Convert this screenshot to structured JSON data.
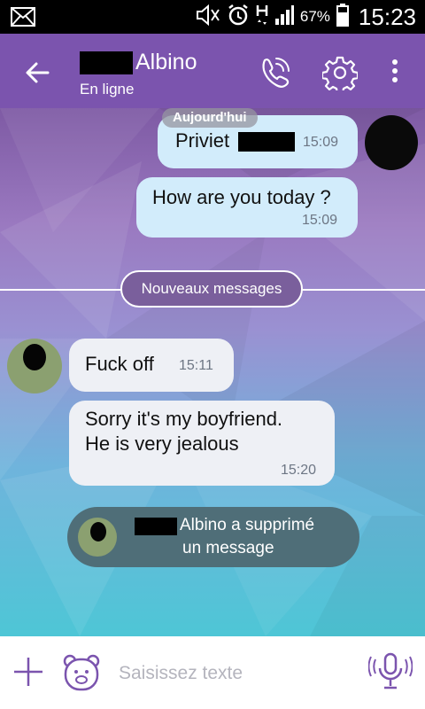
{
  "status_bar": {
    "battery_percent": "67%",
    "time": "15:23",
    "icons": [
      "mail-icon",
      "mute-icon",
      "alarm-icon",
      "data-h-icon",
      "signal-icon",
      "battery-icon"
    ]
  },
  "header": {
    "title": "Albino",
    "subtitle": "En ligne",
    "icons": [
      "back-arrow-icon",
      "phone-icon",
      "gear-icon",
      "more-vert-icon"
    ]
  },
  "chat": {
    "day_label": "Aujourd'hui",
    "messages": [
      {
        "direction": "out",
        "text": "Priviet",
        "time": "15:09"
      },
      {
        "direction": "out",
        "text": "How are you today ?",
        "time": "15:09"
      },
      {
        "direction": "in",
        "text": "Fuck off",
        "time": "15:11"
      },
      {
        "direction": "in",
        "lines": [
          "Sorry it's my boyfriend.",
          "He is very jealous"
        ],
        "time": "15:20"
      }
    ],
    "new_messages_label": "Nouveaux messages",
    "system_message": {
      "line1": "Albino a supprimé",
      "line2": "un message"
    }
  },
  "composer": {
    "placeholder": "Saisissez texte",
    "icons": [
      "plus-icon",
      "sticker-bear-icon",
      "microphone-icon"
    ]
  },
  "colors": {
    "header": "#7b54ae",
    "outgoing_bubble": "#d2ecfb",
    "incoming_bubble": "#eef0f5",
    "accent": "#7b54ae"
  }
}
